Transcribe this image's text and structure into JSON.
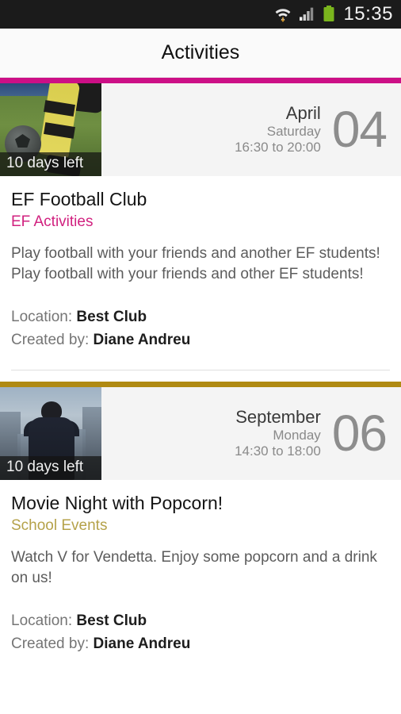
{
  "status_bar": {
    "icons": [
      "wifi-download-icon",
      "cellular-signal-icon",
      "battery-icon"
    ],
    "time": "15:35",
    "background_color": "#1b1b1b"
  },
  "header": {
    "title": "Activities",
    "background_color": "#fafafa"
  },
  "colors": {
    "accent_pink": "#cc0f86",
    "accent_gold": "#b08a12",
    "category_pink": "#d1217f",
    "category_gold": "#b5a24a",
    "day_number": "#8d8d8d"
  },
  "activities": [
    {
      "accent_color": "#cc0f86",
      "category_color": "#d1217f",
      "thumbnail": "football-player-kicking-ball-image",
      "days_left_badge": "10 days left",
      "month": "April",
      "weekday": "Saturday",
      "time_range": "16:30 to 20:00",
      "day_number": "04",
      "title": "EF Football Club",
      "category": "EF Activities",
      "description": "Play football with your friends and another EF students! Play football with your friends and other EF students!",
      "location_label": "Location:",
      "location_value": "Best Club",
      "created_by_label": "Created by:",
      "created_by_value": "Diane Andreu"
    },
    {
      "accent_color": "#b08a12",
      "category_color": "#b5a24a",
      "thumbnail": "man-in-suit-city-skyline-movie-poster-image",
      "days_left_badge": "10 days left",
      "month": "September",
      "weekday": "Monday",
      "time_range": "14:30 to 18:00",
      "day_number": "06",
      "title": "Movie Night with Popcorn!",
      "category": "School Events",
      "description": "Watch V for Vendetta. Enjoy some popcorn and a drink on us!",
      "location_label": "Location:",
      "location_value": "Best Club",
      "created_by_label": "Created by:",
      "created_by_value": "Diane Andreu"
    }
  ]
}
